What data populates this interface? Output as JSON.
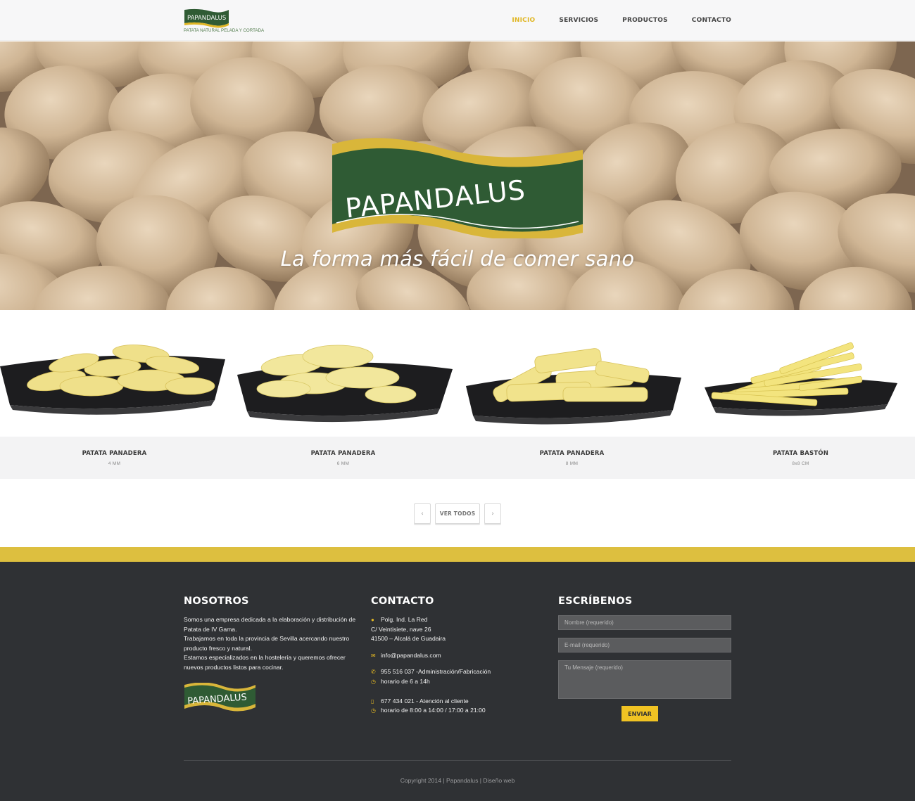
{
  "header": {
    "logo_text": "PAPANDALUS",
    "logo_subtitle": "PATATA NATURAL PELADA Y CORTADA",
    "nav": [
      {
        "label": "INICIO",
        "active": true
      },
      {
        "label": "SERVICIOS",
        "active": false
      },
      {
        "label": "PRODUCTOS",
        "active": false
      },
      {
        "label": "CONTACTO",
        "active": false
      }
    ]
  },
  "hero": {
    "brand": "PAPANDALUS",
    "tagline": "La forma más fácil de comer sano"
  },
  "products": [
    {
      "name": "PATATA PANADERA",
      "size": "4 MM"
    },
    {
      "name": "PATATA PANADERA",
      "size": "6 MM"
    },
    {
      "name": "PATATA PANADERA",
      "size": "8 MM"
    },
    {
      "name": "PATATA BASTÓN",
      "size": "8x8 CM"
    }
  ],
  "pager": {
    "prev": "‹",
    "view_all": "VER TODOS",
    "next": "›"
  },
  "footer": {
    "about": {
      "title": "NOSOTROS",
      "lines": [
        "Somos una empresa dedicada a la elaboración y distribución de Patata de IV Gama.",
        "Trabajamos en toda la provincia de Sevilla acercando nuestro producto fresco y natural.",
        "Estamos especializados en la hostelería y queremos ofrecer nuevos productos listos para cocinar."
      ],
      "logo_text": "PAPANDALUS"
    },
    "contact": {
      "title": "CONTACTO",
      "address": [
        "Polg. Ind. La Red",
        "C/ Veintisiete, nave 26",
        "41500 – Alcalá de Guadaira"
      ],
      "email": "info@papandalus.com",
      "phone1": "955 516 037 -Administración/Fabricación",
      "hours1": "horario de 6 a 14h",
      "phone2": "677 434 021 - Atención al cliente",
      "hours2": "horario de 8:00 a 14:00 / 17:00 a 21:00"
    },
    "form": {
      "title": "ESCRÍBENOS",
      "name_placeholder": "Nombre (requerido)",
      "email_placeholder": "E-mail (requerido)",
      "message_placeholder": "Tu Mensaje (requerido)",
      "submit": "ENVIAR"
    },
    "copyright": "Copyright 2014 | Papandalus | Diseño web"
  },
  "colors": {
    "accent_yellow": "#e0b623",
    "band_yellow": "#ddbf3f",
    "brand_green": "#2f5b34",
    "footer_bg": "#2f3134"
  }
}
